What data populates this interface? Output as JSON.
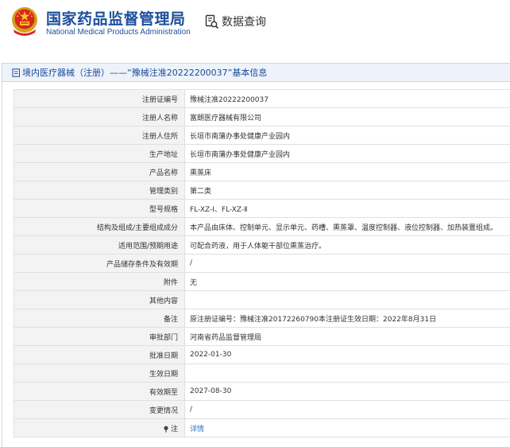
{
  "header": {
    "site_name_cn": "国家药品监督管理局",
    "site_name_en": "National Medical Products Administration",
    "section_label": "数据查询",
    "brand_color": "#1d4f9c"
  },
  "title_bar": {
    "icon": "document-icon",
    "text": "境内医疗器械（注册）——“豫械注准20222200037”基本信息"
  },
  "details": [
    {
      "label": "注册证编号",
      "value": "豫械注准20222200037"
    },
    {
      "label": "注册人名称",
      "value": "富朗医疗器械有限公司"
    },
    {
      "label": "注册人住所",
      "value": "长垣市南蒲办事处健康产业园内"
    },
    {
      "label": "生产地址",
      "value": "长垣市南蒲办事处健康产业园内"
    },
    {
      "label": "产品名称",
      "value": "熏蒸床"
    },
    {
      "label": "管理类别",
      "value": "第二类"
    },
    {
      "label": "型号规格",
      "value": "FL-XZ-Ⅰ、FL-XZ-Ⅱ"
    },
    {
      "label": "结构及组成/主要组成成分",
      "value": "本产品由床体、控制单元、显示单元、药槽、熏蒸罩、温度控制器、液位控制器、加热装置组成。"
    },
    {
      "label": "适用范围/预期用途",
      "value": "可配合药液，用于人体躯干部位熏蒸治疗。"
    },
    {
      "label": "产品储存条件及有效期",
      "value": "/"
    },
    {
      "label": "附件",
      "value": "无"
    },
    {
      "label": "其他内容",
      "value": ""
    },
    {
      "label": "备注",
      "value": "原注册证编号：豫械注准20172260790本注册证生效日期：2022年8月31日"
    },
    {
      "label": "审批部门",
      "value": "河南省药品监督管理局"
    },
    {
      "label": "批准日期",
      "value": "2022-01-30"
    },
    {
      "label": "生效日期",
      "value": ""
    },
    {
      "label": "有效期至",
      "value": "2027-08-30"
    },
    {
      "label": "变更情况",
      "value": "/"
    },
    {
      "label": "注",
      "value": "详情",
      "icon": "info-pin-icon",
      "link": true
    }
  ]
}
